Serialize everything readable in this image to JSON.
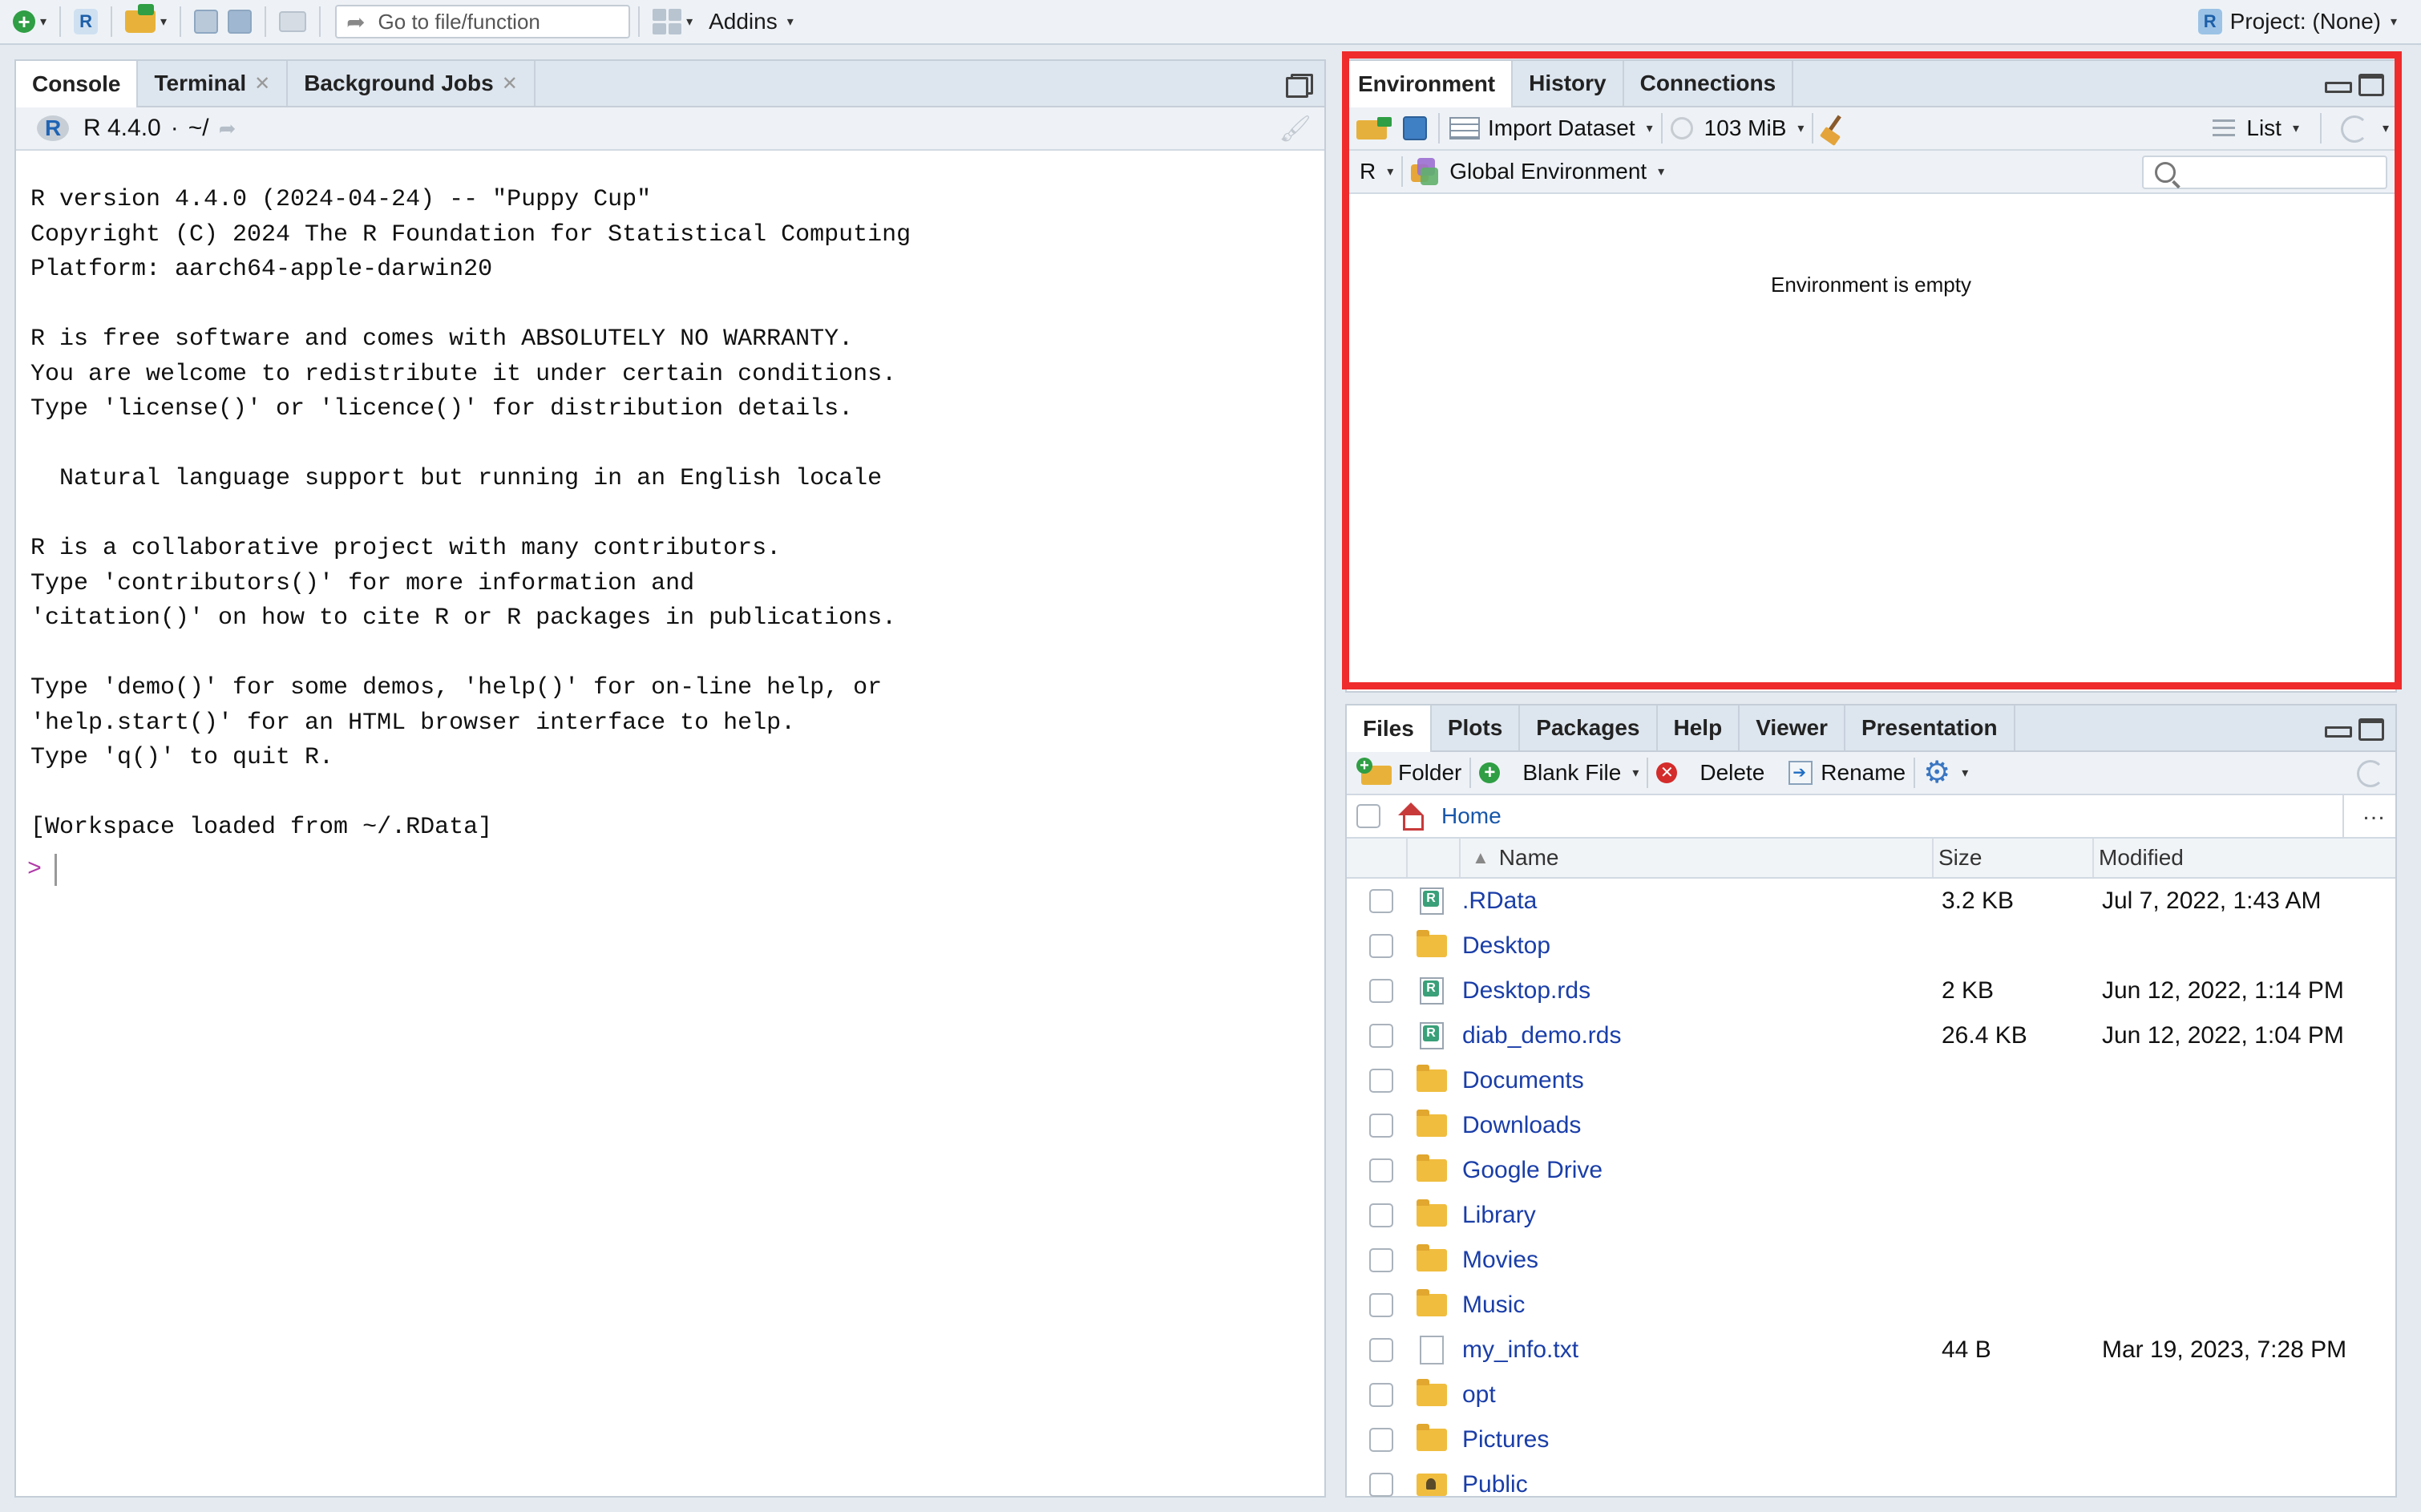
{
  "toolbar": {
    "goto_placeholder": "Go to file/function",
    "addins_label": "Addins",
    "project_label": "Project: (None)"
  },
  "console": {
    "tabs": [
      {
        "label": "Console",
        "active": true,
        "closable": false
      },
      {
        "label": "Terminal",
        "active": false,
        "closable": true
      },
      {
        "label": "Background Jobs",
        "active": false,
        "closable": true
      }
    ],
    "r_version": "R 4.4.0",
    "working_dir": "~/",
    "lines": [
      "R version 4.4.0 (2024-04-24) -- \"Puppy Cup\"",
      "Copyright (C) 2024 The R Foundation for Statistical Computing",
      "Platform: aarch64-apple-darwin20",
      "",
      "R is free software and comes with ABSOLUTELY NO WARRANTY.",
      "You are welcome to redistribute it under certain conditions.",
      "Type 'license()' or 'licence()' for distribution details.",
      "",
      "  Natural language support but running in an English locale",
      "",
      "R is a collaborative project with many contributors.",
      "Type 'contributors()' for more information and",
      "'citation()' on how to cite R or R packages in publications.",
      "",
      "Type 'demo()' for some demos, 'help()' for on-line help, or",
      "'help.start()' for an HTML browser interface to help.",
      "Type 'q()' to quit R.",
      "",
      "[Workspace loaded from ~/.RData]"
    ],
    "prompt": ">"
  },
  "environment": {
    "tabs": [
      {
        "label": "Environment",
        "active": true
      },
      {
        "label": "History",
        "active": false
      },
      {
        "label": "Connections",
        "active": false
      }
    ],
    "import_label": "Import Dataset",
    "memory_label": "103 MiB",
    "view_label": "List",
    "language": "R",
    "scope_label": "Global Environment",
    "search_placeholder": "",
    "empty_message": "Environment is empty",
    "highlight_color": "#ef2b2b"
  },
  "files": {
    "tabs": [
      {
        "label": "Files",
        "active": true
      },
      {
        "label": "Plots",
        "active": false
      },
      {
        "label": "Packages",
        "active": false
      },
      {
        "label": "Help",
        "active": false
      },
      {
        "label": "Viewer",
        "active": false
      },
      {
        "label": "Presentation",
        "active": false
      }
    ],
    "toolbar": {
      "folder_label": "Folder",
      "blank_file_label": "Blank File",
      "delete_label": "Delete",
      "rename_label": "Rename"
    },
    "breadcrumb": "Home",
    "more": "…",
    "columns": {
      "name": "Name",
      "size": "Size",
      "modified": "Modified"
    },
    "rows": [
      {
        "icon": "rdata-file-icon",
        "name": ".RData",
        "size": "3.2 KB",
        "modified": "Jul 7, 2022, 1:43 AM"
      },
      {
        "icon": "folder-icon",
        "name": "Desktop",
        "size": "",
        "modified": ""
      },
      {
        "icon": "rdata-file-icon",
        "name": "Desktop.rds",
        "size": "2 KB",
        "modified": "Jun 12, 2022, 1:14 PM"
      },
      {
        "icon": "rdata-file-icon",
        "name": "diab_demo.rds",
        "size": "26.4 KB",
        "modified": "Jun 12, 2022, 1:04 PM"
      },
      {
        "icon": "folder-icon",
        "name": "Documents",
        "size": "",
        "modified": ""
      },
      {
        "icon": "folder-icon",
        "name": "Downloads",
        "size": "",
        "modified": ""
      },
      {
        "icon": "folder-icon",
        "name": "Google Drive",
        "size": "",
        "modified": ""
      },
      {
        "icon": "folder-icon",
        "name": "Library",
        "size": "",
        "modified": ""
      },
      {
        "icon": "folder-icon",
        "name": "Movies",
        "size": "",
        "modified": ""
      },
      {
        "icon": "folder-icon",
        "name": "Music",
        "size": "",
        "modified": ""
      },
      {
        "icon": "text-file-icon",
        "name": "my_info.txt",
        "size": "44 B",
        "modified": "Mar 19, 2023, 7:28 PM"
      },
      {
        "icon": "folder-icon",
        "name": "opt",
        "size": "",
        "modified": ""
      },
      {
        "icon": "folder-icon",
        "name": "Pictures",
        "size": "",
        "modified": ""
      },
      {
        "icon": "public-folder-icon",
        "name": "Public",
        "size": "",
        "modified": ""
      }
    ]
  }
}
